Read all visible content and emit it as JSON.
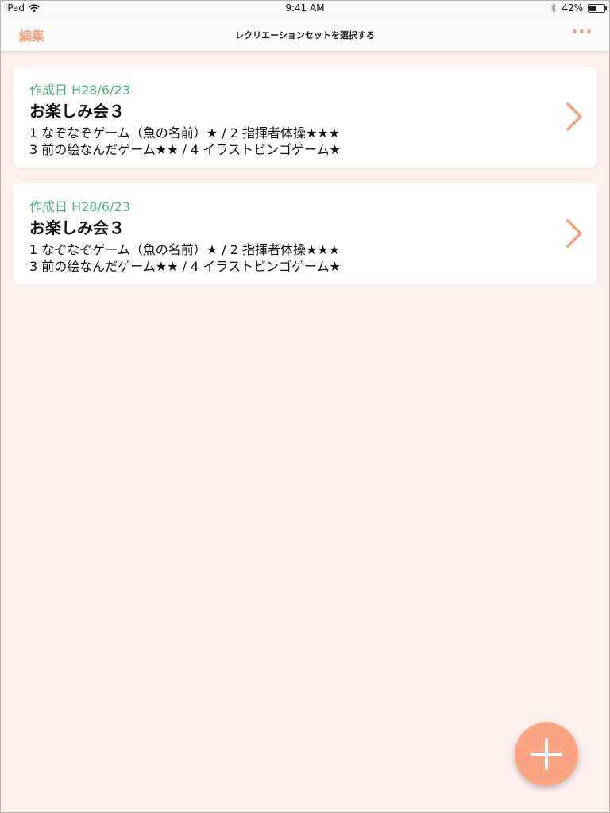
{
  "status_bar": {
    "device": "iPad",
    "time": "9:41 AM",
    "battery_percent": "42%",
    "battery_level": 0.42
  },
  "nav": {
    "edit_label": "編集",
    "title": "レクリエーションセットを選択する"
  },
  "cards": [
    {
      "date": "作成日 H28/6/23",
      "title": "お楽しみ会３",
      "line1": "1 なぞなぞゲーム（魚の名前）★ / 2 指揮者体操★★★",
      "line2": "3 前の絵なんだゲーム★★ / 4 イラストビンゴゲーム★"
    },
    {
      "date": "作成日 H28/6/23",
      "title": "お楽しみ会３",
      "line1": "1 なぞなぞゲーム（魚の名前）★ / 2 指揮者体操★★★",
      "line2": "3 前の絵なんだゲーム★★ / 4 イラストビンゴゲーム★"
    }
  ],
  "colors": {
    "accent": "#f4a17e",
    "date_green": "#4fb27e",
    "background": "#fdf1ee",
    "fab": "#fda583"
  },
  "icons": {
    "wifi": "wifi-icon",
    "bluetooth": "bluetooth-icon",
    "battery": "battery-icon",
    "more": "more-dots-icon",
    "chevron": "chevron-right-icon",
    "add": "plus-icon"
  }
}
